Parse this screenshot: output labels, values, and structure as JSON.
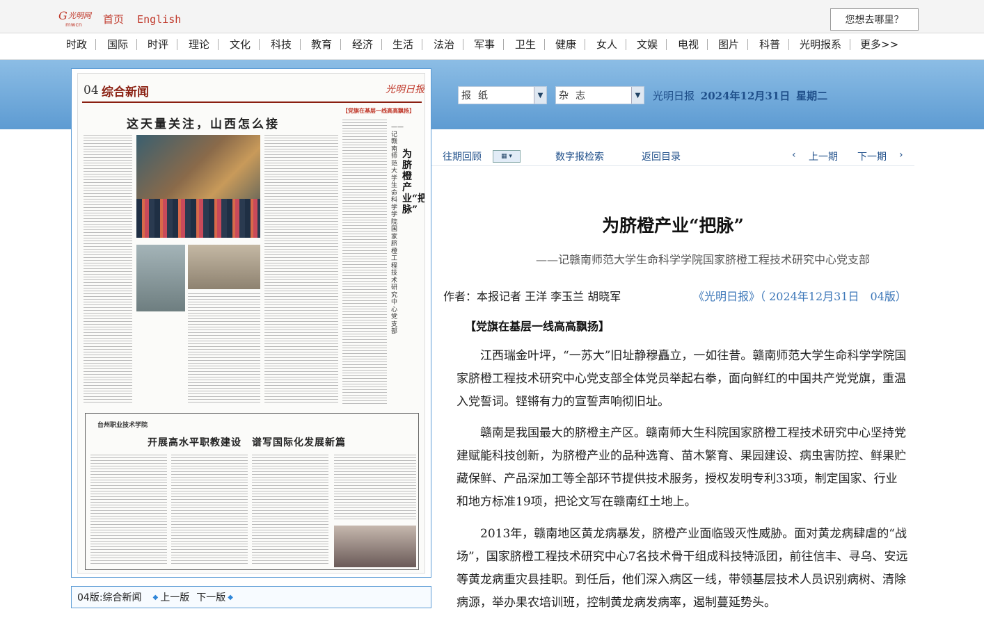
{
  "top": {
    "home": "首页",
    "english": "English",
    "search_placeholder": "您想去哪里？"
  },
  "nav": [
    "时政",
    "国际",
    "时评",
    "理论",
    "文化",
    "科技",
    "教育",
    "经济",
    "生活",
    "法治",
    "军事",
    "卫生",
    "健康",
    "女人",
    "文娱",
    "电视",
    "图片",
    "科普",
    "光明报系",
    "更多>>"
  ],
  "paper_page": {
    "number": "04",
    "section": "综合新闻",
    "masthead": "光明日报",
    "headline": "这天量关注，山西怎么接",
    "tag": "【党旗在基层一线高高飘扬】",
    "vertical_title": "为脐橙产业“把脉”",
    "vertical_subtitle": "——记赣南师范大学生命科学学院国家脐橙工程技术研究中心党支部",
    "ad_school": "台州职业技术学院",
    "ad_title": "开展高水平职教建设　谱写国际化发展新篇"
  },
  "pager": {
    "current": "04版:综合新闻",
    "prev": "上一版",
    "next": "下一版"
  },
  "controls": {
    "select_paper": "报纸",
    "select_magazine": "杂志",
    "paper_name": "光明日报",
    "date": "2024年12月31日",
    "weekday": "星期二"
  },
  "tools": {
    "history": "往期回顾",
    "search": "数字报检索",
    "back": "返回目录",
    "prev_issue": "上一期",
    "next_issue": "下一期"
  },
  "article": {
    "title": "为脐橙产业“把脉”",
    "subtitle": "——记赣南师范大学生命科学学院国家脐橙工程技术研究中心党支部",
    "byline": "作者：本报记者 王洋 李玉兰 胡晓军",
    "source": "《光明日报》（ 2024年12月31日　04版）",
    "column": "【党旗在基层一线高高飘扬】",
    "paragraphs": [
      "江西瑞金叶坪，“一苏大”旧址静穆矗立，一如往昔。赣南师范大学生命科学学院国家脐橙工程技术研究中心党支部全体党员举起右拳，面向鲜红的中国共产党党旗，重温入党誓词。铿锵有力的宣誓声响彻旧址。",
      "赣南是我国最大的脐橙主产区。赣南师大生科院国家脐橙工程技术研究中心坚持党建赋能科技创新，为脐橙产业的品种选育、苗木繁育、果园建设、病虫害防控、鲜果贮藏保鲜、产品深加工等全部环节提供技术服务，授权发明专利33项，制定国家、行业和地方标准19项，把论文写在赣南红土地上。",
      "2013年，赣南地区黄龙病暴发，脐橙产业面临毁灭性威胁。面对黄龙病肆虐的“战场”，国家脐橙工程技术研究中心7名技术骨干组成科技特派团，前往信丰、寻乌、安远等黄龙病重灾县挂职。到任后，他们深入病区一线，带领基层技术人员识别病树、清除病源，举办果农培训班，控制黄龙病发病率，遏制蔓延势头。"
    ]
  }
}
